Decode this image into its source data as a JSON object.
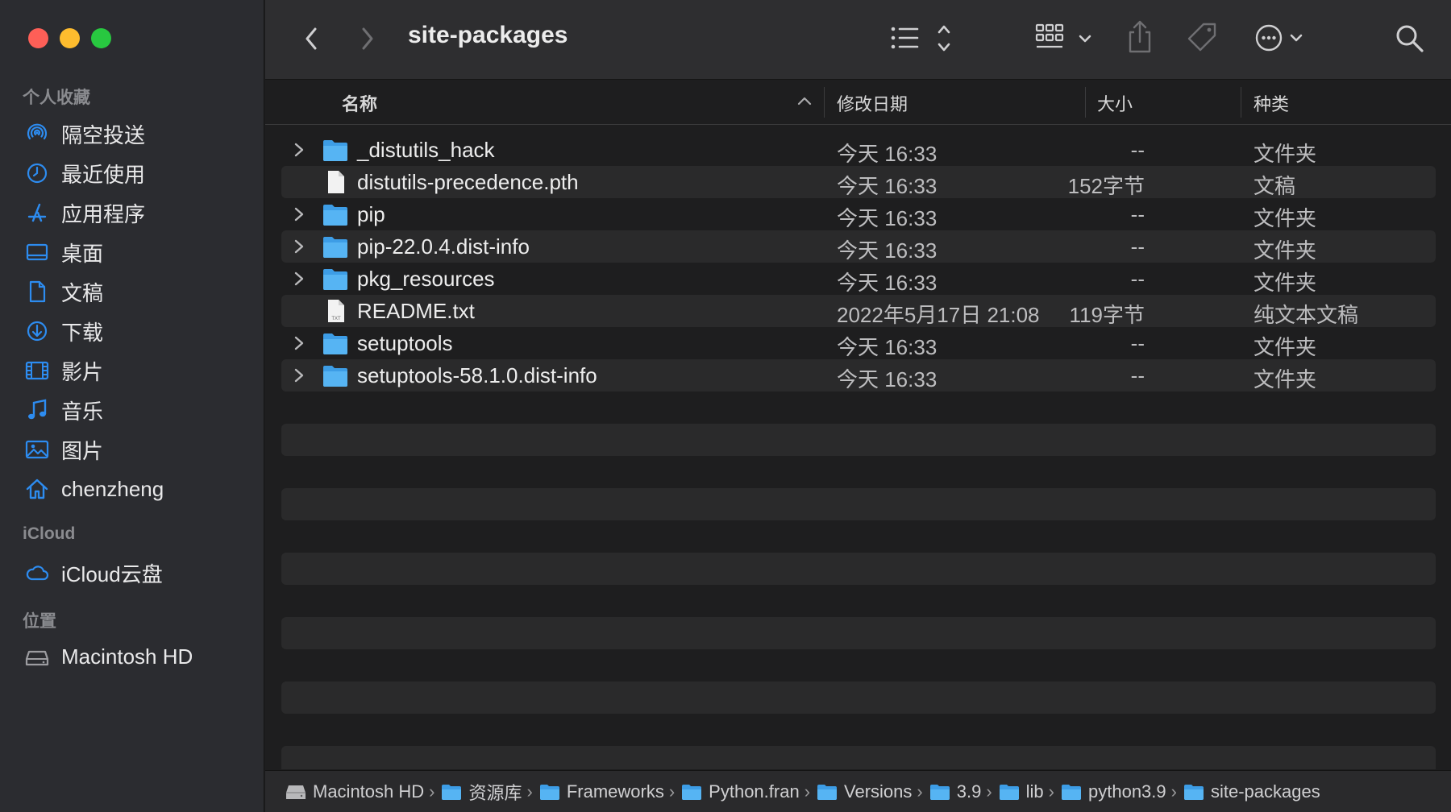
{
  "window": {
    "title": "site-packages"
  },
  "sidebar": {
    "favorites_title": "个人收藏",
    "favorites": [
      {
        "label": "隔空投送",
        "icon": "airdrop-icon"
      },
      {
        "label": "最近使用",
        "icon": "clock-icon"
      },
      {
        "label": "应用程序",
        "icon": "applications-icon"
      },
      {
        "label": "桌面",
        "icon": "desktop-icon"
      },
      {
        "label": "文稿",
        "icon": "document-icon"
      },
      {
        "label": "下载",
        "icon": "download-icon"
      },
      {
        "label": "影片",
        "icon": "film-icon"
      },
      {
        "label": "音乐",
        "icon": "music-note-icon"
      },
      {
        "label": "图片",
        "icon": "photo-icon"
      },
      {
        "label": "chenzheng",
        "icon": "home-icon"
      }
    ],
    "icloud_title": "iCloud",
    "icloud": [
      {
        "label": "iCloud云盘",
        "icon": "cloud-icon"
      }
    ],
    "locations_title": "位置",
    "locations": [
      {
        "label": "Macintosh HD",
        "icon": "disk-icon"
      }
    ]
  },
  "columns": {
    "name": "名称",
    "date": "修改日期",
    "size": "大小",
    "kind": "种类"
  },
  "files": [
    {
      "name": "_distutils_hack",
      "date": "今天 16:33",
      "size": "--",
      "kind": "文件夹",
      "type": "folder"
    },
    {
      "name": "distutils-precedence.pth",
      "date": "今天 16:33",
      "size": "152字节",
      "kind": "文稿",
      "type": "file"
    },
    {
      "name": "pip",
      "date": "今天 16:33",
      "size": "--",
      "kind": "文件夹",
      "type": "folder"
    },
    {
      "name": "pip-22.0.4.dist-info",
      "date": "今天 16:33",
      "size": "--",
      "kind": "文件夹",
      "type": "folder"
    },
    {
      "name": "pkg_resources",
      "date": "今天 16:33",
      "size": "--",
      "kind": "文件夹",
      "type": "folder"
    },
    {
      "name": "README.txt",
      "date": "2022年5月17日 21:08",
      "size": "119字节",
      "kind": "纯文本文稿",
      "type": "txt"
    },
    {
      "name": "setuptools",
      "date": "今天 16:33",
      "size": "--",
      "kind": "文件夹",
      "type": "folder"
    },
    {
      "name": "setuptools-58.1.0.dist-info",
      "date": "今天 16:33",
      "size": "--",
      "kind": "文件夹",
      "type": "folder"
    }
  ],
  "pathbar": [
    {
      "label": "Macintosh HD",
      "icon": "disk-icon"
    },
    {
      "label": "资源库",
      "icon": "folder-icon"
    },
    {
      "label": "Frameworks",
      "icon": "folder-icon"
    },
    {
      "label": "Python.fran",
      "icon": "folder-icon"
    },
    {
      "label": "Versions",
      "icon": "folder-icon"
    },
    {
      "label": "3.9",
      "icon": "folder-icon"
    },
    {
      "label": "lib",
      "icon": "folder-icon"
    },
    {
      "label": "python3.9",
      "icon": "folder-icon"
    },
    {
      "label": "site-packages",
      "icon": "folder-icon"
    }
  ],
  "colors": {
    "accent": "#2d8cf0",
    "folder": "#4aa8ef",
    "sidebar_bg": "#2b2c30",
    "list_bg": "#1e1e1f"
  }
}
